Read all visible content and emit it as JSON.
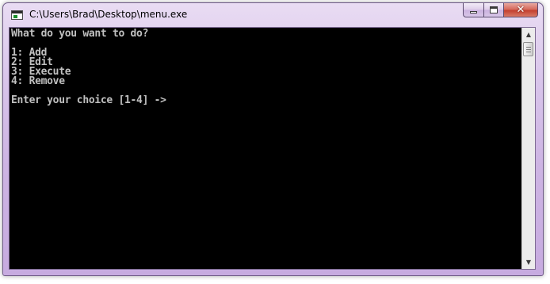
{
  "window": {
    "title": "C:\\Users\\Brad\\Desktop\\menu.exe",
    "controls": {
      "minimize": "minimize",
      "maximize": "maximize",
      "close": "close"
    }
  },
  "console": {
    "lines": [
      "What do you want to do?",
      "",
      "1: Add",
      "2: Edit",
      "3: Execute",
      "4: Remove",
      "",
      "Enter your choice [1-4] ->"
    ],
    "text_color": "#c0c0c0",
    "background_color": "#000000"
  },
  "icons": {
    "app": "console-app-icon",
    "minimize": "minimize-icon",
    "maximize": "maximize-icon",
    "close": "close-icon",
    "scroll_up": "arrow-up-icon",
    "scroll_down": "arrow-down-icon"
  },
  "theme": {
    "frame_color": "#cdb4e3",
    "close_button_color": "#c3402f"
  }
}
